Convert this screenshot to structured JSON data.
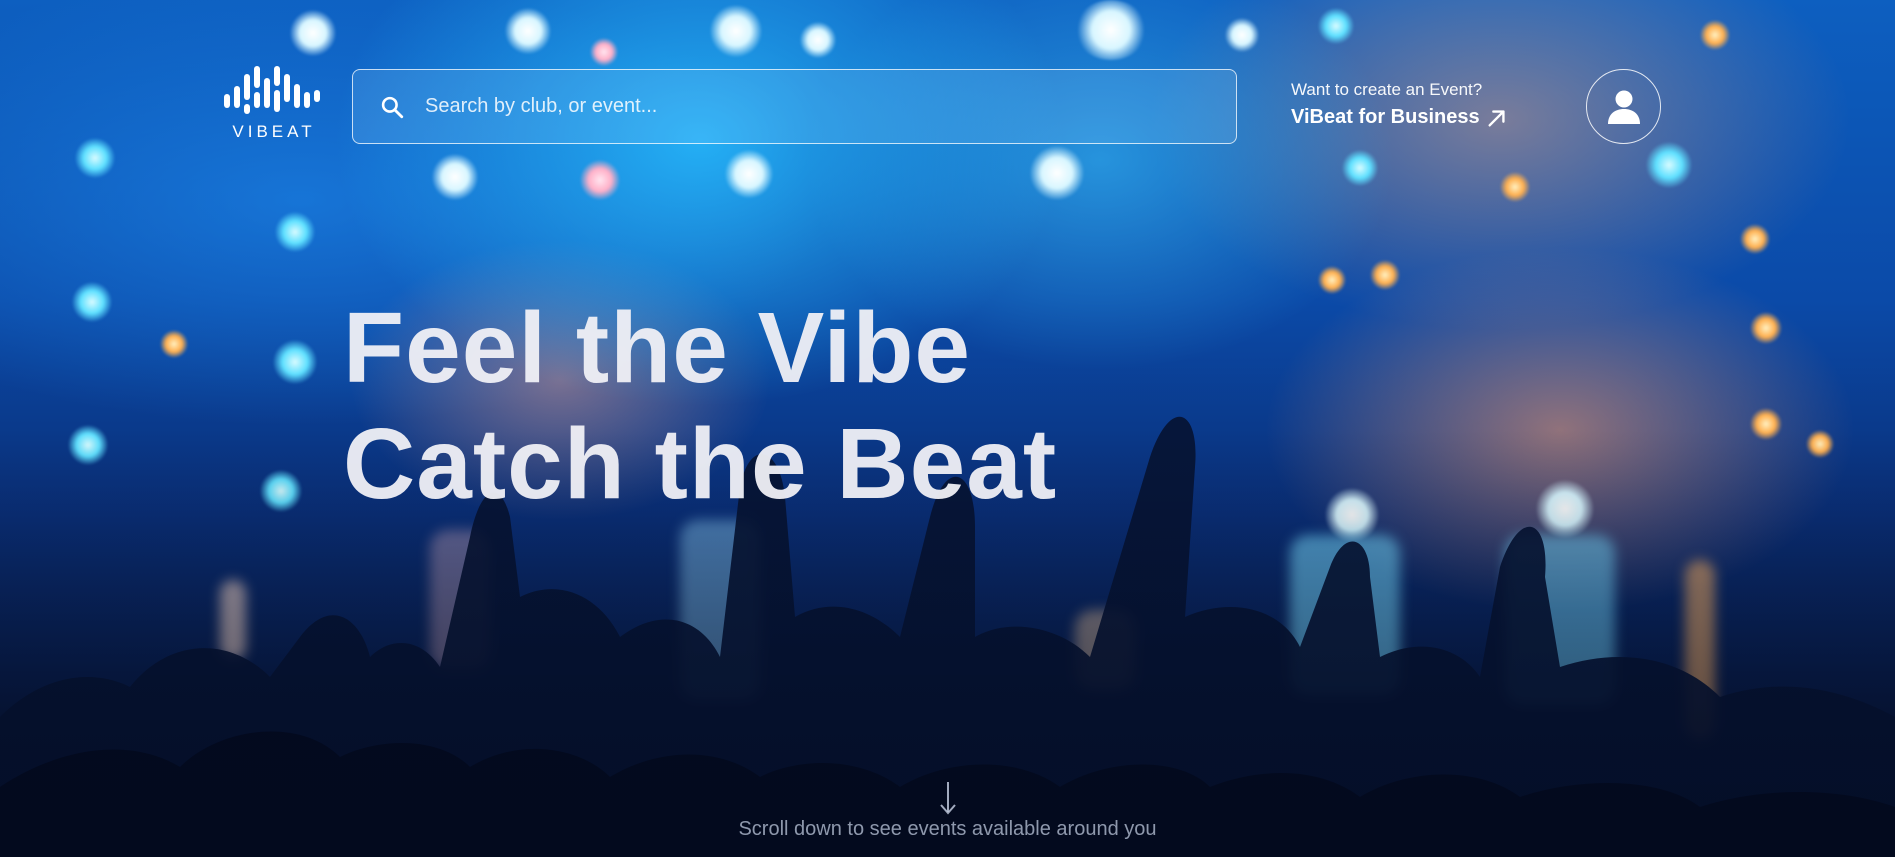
{
  "brand": {
    "name": "VIBEAT"
  },
  "search": {
    "placeholder": "Search by club, or event...",
    "value": ""
  },
  "business": {
    "prompt": "Want to create an Event?",
    "link_label": "ViBeat for Business"
  },
  "hero": {
    "line1": "Feel the Vibe",
    "line2": "Catch the Beat"
  },
  "scroll_hint": {
    "text": "Scroll down to see events available around you"
  },
  "icons": {
    "logo": "soundwave-logo-icon",
    "search": "search-icon",
    "business_link": "arrow-up-right-icon",
    "account": "user-icon",
    "scroll": "arrow-down-icon"
  },
  "colors": {
    "text": "#ffffff",
    "background_top": "#0d5fc0",
    "background_bottom": "#050d24"
  }
}
